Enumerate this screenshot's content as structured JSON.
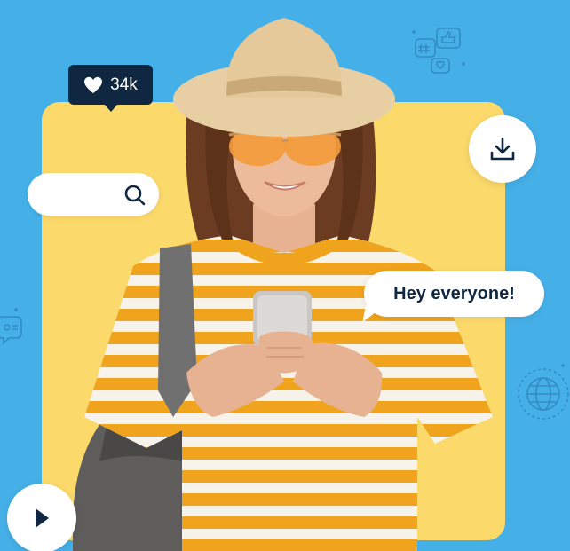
{
  "like_tooltip": {
    "icon": "heart-icon",
    "count": "34k"
  },
  "search": {
    "icon": "search-icon",
    "value": ""
  },
  "download": {
    "icon": "download-icon"
  },
  "speech_bubble": {
    "text": "Hey everyone!"
  },
  "play": {
    "icon": "play-icon"
  },
  "decorations": {
    "top_right": "social-cluster-icon",
    "left": "chat-eye-icon",
    "right": "globe-icon"
  },
  "colors": {
    "background": "#45b0e8",
    "card": "#fbd96a",
    "dark_navy": "#0f2740",
    "shirt_stripe": "#f0a31d",
    "hat": "#e8cfa3"
  }
}
